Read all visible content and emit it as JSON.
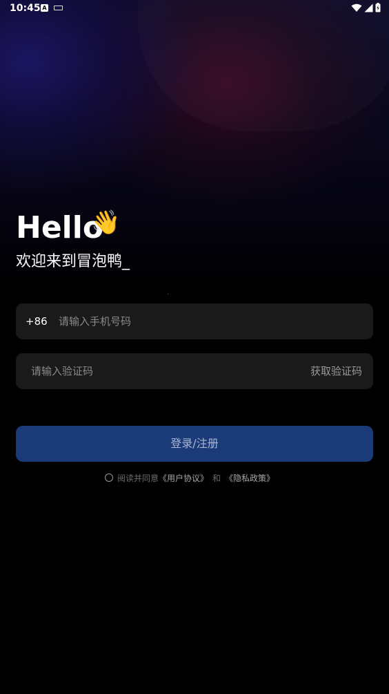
{
  "status_bar": {
    "time": "10:45",
    "app_icon_letter": "A"
  },
  "greeting": {
    "hello": "Hello",
    "wave_emoji": "👋",
    "welcome": "欢迎来到冒泡鸭_"
  },
  "phone_input": {
    "country_code": "+86",
    "placeholder": "请输入手机号码",
    "value": ""
  },
  "code_input": {
    "placeholder": "请输入验证码",
    "value": "",
    "get_code_label": "获取验证码"
  },
  "login_button": {
    "label": "登录/注册"
  },
  "agreement": {
    "prefix": "阅读并同意",
    "user_agreement": "《用户协议》",
    "separator": "和",
    "privacy_policy": "《隐私政策》",
    "checked": false
  },
  "colors": {
    "background": "#000000",
    "input_bg": "#1a1a1a",
    "button_bg": "#1b3a78",
    "button_text": "#a9b6d2",
    "placeholder": "#8a8a8a"
  }
}
